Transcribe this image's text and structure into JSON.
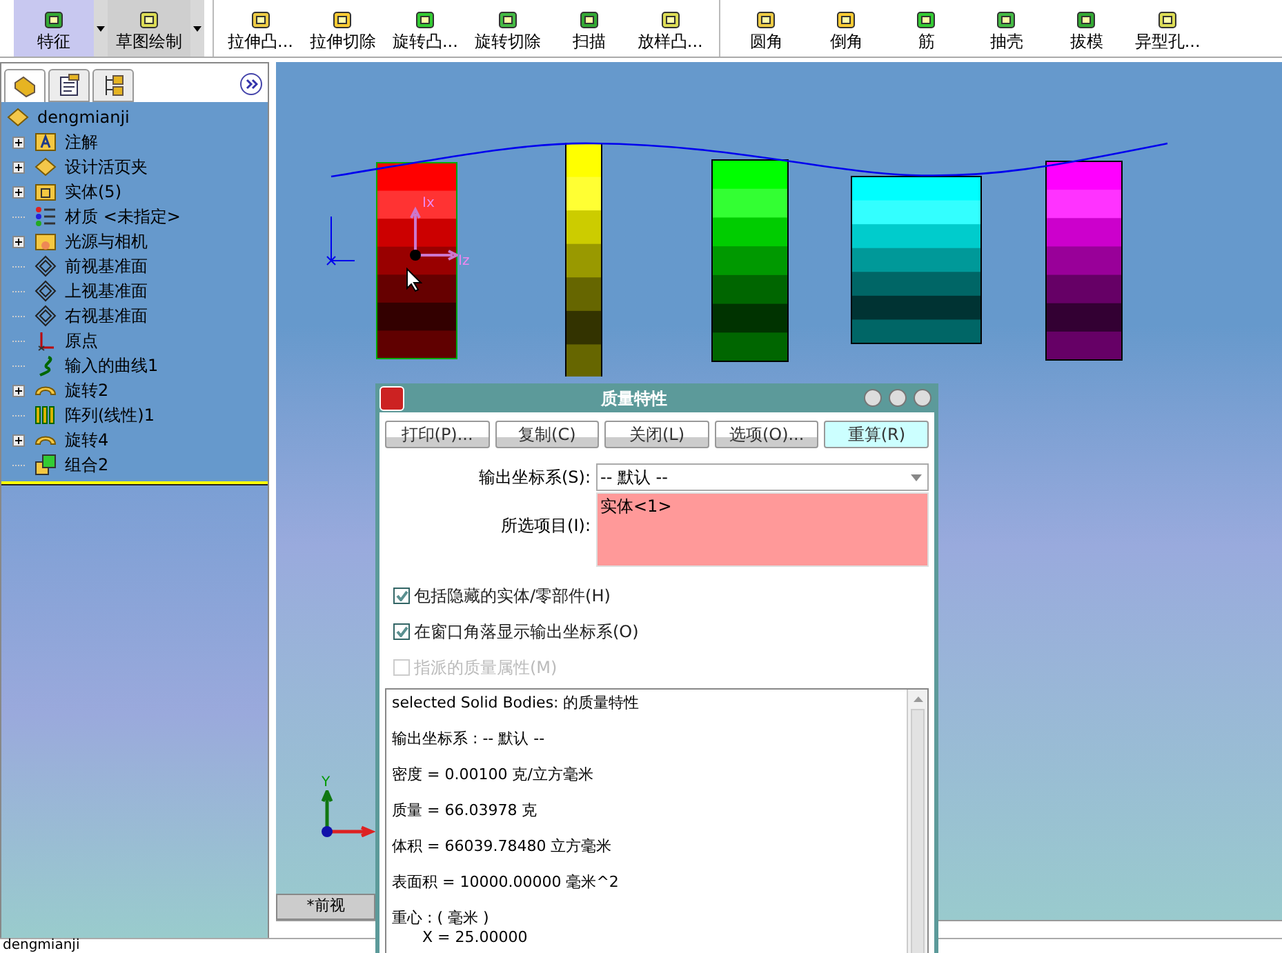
{
  "toolbar": {
    "items": [
      {
        "label": "特征",
        "selected": true,
        "dropdown": true
      },
      {
        "label": "草图绘制",
        "selected": true,
        "dropdown": true
      },
      {
        "label": "拉伸凸...",
        "selected": false,
        "dropdown": false
      },
      {
        "label": "拉伸切除",
        "selected": false,
        "dropdown": false
      },
      {
        "label": "旋转凸...",
        "selected": false,
        "dropdown": false
      },
      {
        "label": "旋转切除",
        "selected": false,
        "dropdown": false
      },
      {
        "label": "扫描",
        "selected": false,
        "dropdown": false
      },
      {
        "label": "放样凸...",
        "selected": false,
        "dropdown": false
      },
      {
        "label": "圆角",
        "selected": false,
        "dropdown": false
      },
      {
        "label": "倒角",
        "selected": false,
        "dropdown": false
      },
      {
        "label": "筋",
        "selected": false,
        "dropdown": false
      },
      {
        "label": "抽壳",
        "selected": false,
        "dropdown": false
      },
      {
        "label": "拔模",
        "selected": false,
        "dropdown": false
      },
      {
        "label": "异型孔...",
        "selected": false,
        "dropdown": false
      }
    ]
  },
  "panel_tabs": [
    {
      "kind": "feature",
      "selected": true
    },
    {
      "kind": "property",
      "selected": false
    },
    {
      "kind": "config",
      "selected": false
    }
  ],
  "tree": {
    "root": "dengmianji",
    "items": [
      {
        "label": "注解",
        "kind": "annotation",
        "collapsed": true
      },
      {
        "label": "设计活页夹",
        "kind": "binder",
        "collapsed": true
      },
      {
        "label": "实体(5)",
        "kind": "bodies",
        "collapsed": true
      },
      {
        "label": "材质 <未指定>",
        "kind": "material",
        "collapsed": false
      },
      {
        "label": "光源与相机",
        "kind": "lights",
        "collapsed": true
      },
      {
        "label": "前视基准面",
        "kind": "plane",
        "collapsed": false
      },
      {
        "label": "上视基准面",
        "kind": "plane",
        "collapsed": false
      },
      {
        "label": "右视基准面",
        "kind": "plane",
        "collapsed": false
      },
      {
        "label": "原点",
        "kind": "origin",
        "collapsed": false
      },
      {
        "label": "输入的曲线1",
        "kind": "curve",
        "collapsed": false
      },
      {
        "label": "旋转2",
        "kind": "revolve",
        "collapsed": true
      },
      {
        "label": "阵列(线性)1",
        "kind": "pattern",
        "collapsed": false
      },
      {
        "label": "旋转4",
        "kind": "revolve",
        "collapsed": true
      },
      {
        "label": "组合2",
        "kind": "combine",
        "collapsed": false
      }
    ]
  },
  "viewport": {
    "axis_labels": [
      "Ix",
      "Iz"
    ],
    "triad_label": "Y",
    "view_tab": "*前视"
  },
  "dialog": {
    "title": "质量特性",
    "buttons": [
      {
        "label": "打印(P)...",
        "selected": false
      },
      {
        "label": "复制(C)",
        "selected": false
      },
      {
        "label": "关闭(L)",
        "selected": false
      },
      {
        "label": "选项(O)...",
        "selected": false
      },
      {
        "label": "重算(R)",
        "selected": true
      }
    ],
    "coord_label": "输出坐标系(S):",
    "coord_value": "-- 默认 --",
    "selection_label": "所选项目(I):",
    "selection_items": [
      "实体<1>"
    ],
    "checkboxes": [
      {
        "label": "包括隐藏的实体/零部件(H)",
        "checked": true,
        "disabled": false
      },
      {
        "label": "在窗口角落显示输出坐标系(O)",
        "checked": true,
        "disabled": false
      },
      {
        "label": "指派的质量属性(M)",
        "checked": false,
        "disabled": true
      }
    ],
    "results": [
      {
        "text": "selected Solid Bodies: 的质量特性",
        "indent": false
      },
      {
        "text": "输出坐标系 : -- 默认 --",
        "indent": false
      },
      {
        "text": "密度 = 0.00100 克/立方毫米",
        "indent": false
      },
      {
        "text": "质量 = 66.03978 克",
        "indent": false
      },
      {
        "text": "体积 = 66039.78480 立方毫米",
        "indent": false
      },
      {
        "text": "表面积 = 10000.00000 毫米^2",
        "indent": false
      },
      {
        "text": "重心 : ( 毫米 )",
        "indent": false
      },
      {
        "text": "X = 25.00000",
        "indent": true
      }
    ]
  },
  "status_bar": "dengmianji"
}
